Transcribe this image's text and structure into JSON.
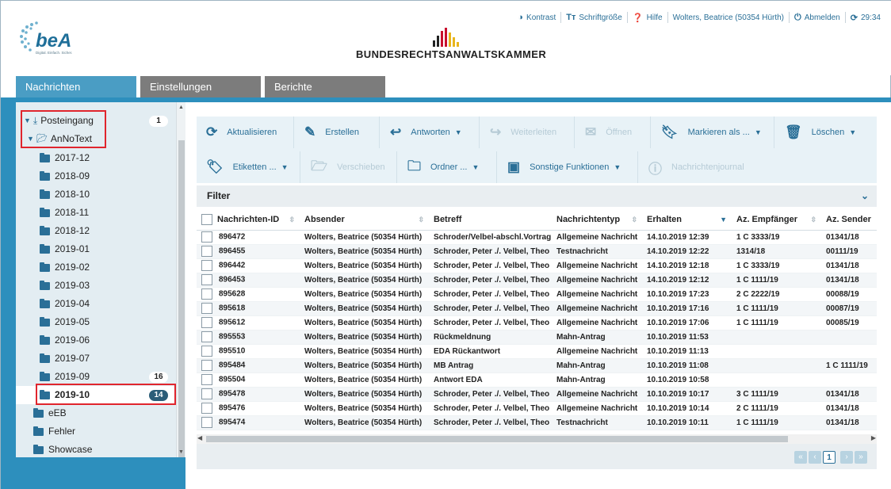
{
  "topbar": {
    "contrast": "Kontrast",
    "fontsize": "Schriftgröße",
    "help": "Hilfe",
    "user": "Wolters, Beatrice (50354 Hürth)",
    "logout": "Abmelden",
    "timer": "29:34"
  },
  "logos": {
    "bea_name": "beA",
    "bea_tagline": "Digital. Einfach. Sicher.",
    "brak_name": "BUNDESRECHTSANWALTSKAMMER"
  },
  "tabs": [
    "Nachrichten",
    "Einstellungen",
    "Berichte"
  ],
  "sidebar": {
    "inbox": {
      "label": "Posteingang",
      "count": "1"
    },
    "annotext": {
      "label": "AnNoText"
    },
    "folders": [
      {
        "label": "2017-12",
        "count": ""
      },
      {
        "label": "2018-09",
        "count": ""
      },
      {
        "label": "2018-10",
        "count": ""
      },
      {
        "label": "2018-11",
        "count": ""
      },
      {
        "label": "2018-12",
        "count": ""
      },
      {
        "label": "2019-01",
        "count": ""
      },
      {
        "label": "2019-02",
        "count": ""
      },
      {
        "label": "2019-03",
        "count": ""
      },
      {
        "label": "2019-04",
        "count": ""
      },
      {
        "label": "2019-05",
        "count": ""
      },
      {
        "label": "2019-06",
        "count": ""
      },
      {
        "label": "2019-07",
        "count": ""
      },
      {
        "label": "2019-09",
        "count": "16"
      },
      {
        "label": "2019-10",
        "count": "14"
      }
    ],
    "other": [
      "eEB",
      "Fehler",
      "Showcase"
    ]
  },
  "toolbar": {
    "refresh": "Aktualisieren",
    "create": "Erstellen",
    "reply": "Antworten",
    "forward": "Weiterleiten",
    "open": "Öffnen",
    "mark": "Markieren als ...",
    "delete": "Löschen",
    "labels": "Etiketten ...",
    "move": "Verschieben",
    "folder": "Ordner ...",
    "other": "Sonstige Funktionen",
    "journal": "Nachrichtenjournal"
  },
  "filter": {
    "label": "Filter"
  },
  "table": {
    "columns": [
      "Nachrichten-ID",
      "Absender",
      "Betreff",
      "Nachrichtentyp",
      "Erhalten",
      "Az. Empfänger",
      "Az. Sender"
    ],
    "rows": [
      [
        "896472",
        "Wolters, Beatrice (50354 Hürth)",
        "Schroder/Velbel-abschl.Vortrag",
        "Allgemeine Nachricht",
        "14.10.2019 12:39",
        "1 C 3333/19",
        "01341/18"
      ],
      [
        "896455",
        "Wolters, Beatrice (50354 Hürth)",
        "Schroder, Peter ./. Velbel, Theo",
        "Testnachricht",
        "14.10.2019 12:22",
        "1314/18",
        "00111/19"
      ],
      [
        "896442",
        "Wolters, Beatrice (50354 Hürth)",
        "Schroder, Peter ./. Velbel, Theo",
        "Allgemeine Nachricht",
        "14.10.2019 12:18",
        "1 C 3333/19",
        "01341/18"
      ],
      [
        "896453",
        "Wolters, Beatrice (50354 Hürth)",
        "Schroder, Peter ./. Velbel, Theo",
        "Allgemeine Nachricht",
        "14.10.2019 12:12",
        "1 C 1111/19",
        "01341/18"
      ],
      [
        "895628",
        "Wolters, Beatrice (50354 Hürth)",
        "Schroder, Peter ./. Velbel, Theo",
        "Allgemeine Nachricht",
        "10.10.2019 17:23",
        "2 C 2222/19",
        "00088/19"
      ],
      [
        "895618",
        "Wolters, Beatrice (50354 Hürth)",
        "Schroder, Peter ./. Velbel, Theo",
        "Allgemeine Nachricht",
        "10.10.2019 17:16",
        "1 C 1111/19",
        "00087/19"
      ],
      [
        "895612",
        "Wolters, Beatrice (50354 Hürth)",
        "Schroder, Peter ./. Velbel, Theo",
        "Allgemeine Nachricht",
        "10.10.2019 17:06",
        "1 C 1111/19",
        "00085/19"
      ],
      [
        "895553",
        "Wolters, Beatrice (50354 Hürth)",
        "Rückmeldnung",
        "Mahn-Antrag",
        "10.10.2019 11:53",
        "",
        ""
      ],
      [
        "895510",
        "Wolters, Beatrice (50354 Hürth)",
        "EDA Rückantwort",
        "Allgemeine Nachricht",
        "10.10.2019 11:13",
        "",
        ""
      ],
      [
        "895484",
        "Wolters, Beatrice (50354 Hürth)",
        "MB Antrag",
        "Mahn-Antrag",
        "10.10.2019 11:08",
        "",
        "1 C 1111/19"
      ],
      [
        "895504",
        "Wolters, Beatrice (50354 Hürth)",
        "Antwort EDA",
        "Mahn-Antrag",
        "10.10.2019 10:58",
        "",
        ""
      ],
      [
        "895478",
        "Wolters, Beatrice (50354 Hürth)",
        "Schroder, Peter ./. Velbel, Theo",
        "Allgemeine Nachricht",
        "10.10.2019 10:17",
        "3 C 1111/19",
        "01341/18"
      ],
      [
        "895476",
        "Wolters, Beatrice (50354 Hürth)",
        "Schroder, Peter ./. Velbel, Theo",
        "Allgemeine Nachricht",
        "10.10.2019 10:14",
        "2 C 1111/19",
        "01341/18"
      ],
      [
        "895474",
        "Wolters, Beatrice (50354 Hürth)",
        "Schroder, Peter ./. Velbel, Theo",
        "Testnachricht",
        "10.10.2019 10:11",
        "1 C 1111/19",
        "01341/18"
      ]
    ]
  },
  "pager": {
    "current": "1"
  },
  "colors": {
    "accent": "#2d8fbd",
    "active_tab": "#4a9dc4",
    "inactive_tab": "#7c7c7c",
    "highlight": "#e0252d"
  }
}
